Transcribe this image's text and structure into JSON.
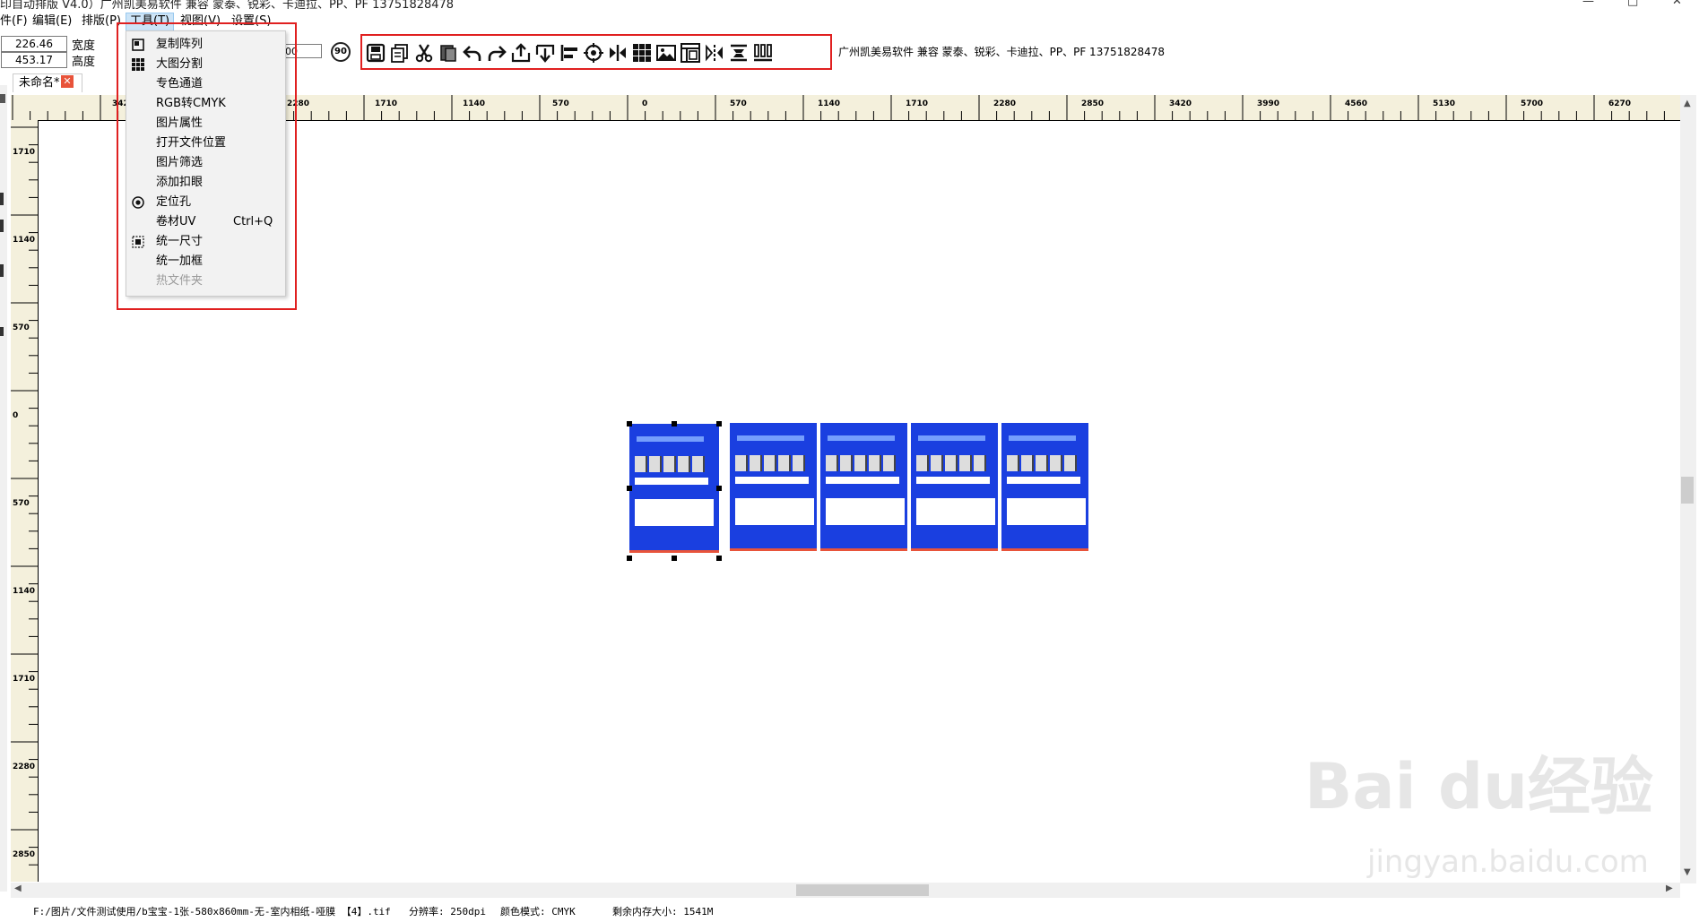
{
  "titlebar": {
    "title": "印自动排版 V4.0）广州凯美易软件 兼容 蒙泰、锐彩、卡迪拉、PP、PF 13751828478",
    "minimize": "—",
    "maximize": "□",
    "close": "✕"
  },
  "menubar": [
    {
      "label": "件(F)"
    },
    {
      "label": "编辑(E)"
    },
    {
      "label": "排版(P)"
    },
    {
      "label": "工具(T)"
    },
    {
      "label": "视图(V)"
    },
    {
      "label": "设置(S)"
    }
  ],
  "props": {
    "x_value": "226.46",
    "y_value": "453.17",
    "width_label": "宽度",
    "height_label": "高度",
    "rotate_value": "00",
    "rotate90_label": "90"
  },
  "toolbar": {
    "company": "广州凯美易软件 兼容 蒙泰、锐彩、卡迪拉、PP、PF  13751828478",
    "icons": [
      "save-icon",
      "copy-icon",
      "cut-icon",
      "paste-icon",
      "undo-icon",
      "redo-icon",
      "export-icon",
      "import-icon",
      "align-left-icon",
      "crosshair-icon",
      "flip-icon",
      "grid-icon",
      "image-icon",
      "layout-icon",
      "mirror-icon",
      "stack-icon",
      "columns-icon"
    ]
  },
  "tab": {
    "label": "未命名*",
    "close": "✕"
  },
  "dropdown": {
    "items": [
      {
        "label": "复制阵列",
        "icon": "copy-array-icon",
        "shortcut": ""
      },
      {
        "label": "大图分割",
        "icon": "grid-split-icon",
        "shortcut": ""
      },
      {
        "label": "专色通道",
        "icon": "",
        "shortcut": ""
      },
      {
        "label": "RGB转CMYK",
        "icon": "",
        "shortcut": ""
      },
      {
        "label": "图片属性",
        "icon": "",
        "shortcut": ""
      },
      {
        "label": "打开文件位置",
        "icon": "",
        "shortcut": ""
      },
      {
        "label": "图片筛选",
        "icon": "",
        "shortcut": ""
      },
      {
        "label": "添加扣眼",
        "icon": "",
        "shortcut": ""
      },
      {
        "label": "定位孔",
        "icon": "target-icon",
        "shortcut": ""
      },
      {
        "label": "卷材UV",
        "icon": "",
        "shortcut": "Ctrl+Q"
      },
      {
        "label": "统一尺寸",
        "icon": "resize-icon",
        "shortcut": ""
      },
      {
        "label": "统一加框",
        "icon": "",
        "shortcut": ""
      },
      {
        "label": "热文件夹",
        "icon": "",
        "shortcut": "",
        "disabled": true
      }
    ]
  },
  "ruler": {
    "h_labels": [
      "342",
      "2280",
      "1710",
      "1140",
      "570",
      "0",
      "570",
      "1140",
      "1710",
      "2280",
      "2850",
      "3420",
      "3990",
      "4560",
      "5130",
      "5700",
      "6270"
    ],
    "v_labels": [
      "1710",
      "1140",
      "570",
      "0",
      "570",
      "1140",
      "1710",
      "2280",
      "2850"
    ]
  },
  "status": {
    "path": "F:/图片/文件测试使用/b宝宝-1张-580x860mm-无-室内相纸-哑膜 【4】.tif",
    "resolution": "分辨率: 250dpi",
    "color_mode": "颜色模式: CMYK",
    "memory": "剩余内存大小: 1541M"
  },
  "watermark": {
    "main": "Bai du经验",
    "sub": "jingyan.baidu.com"
  }
}
